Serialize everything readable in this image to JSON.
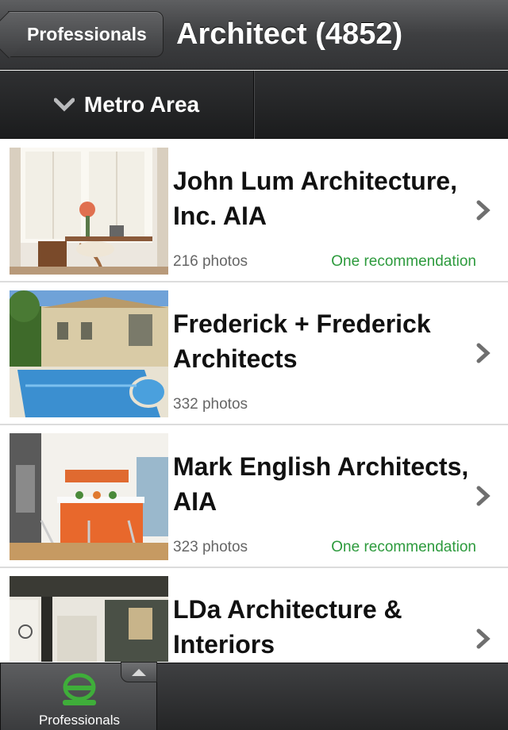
{
  "navbar": {
    "back_label": "Professionals",
    "title": "Architect (4852)"
  },
  "filter": {
    "metro_label": "Metro Area"
  },
  "listings": [
    {
      "name": "John Lum Architecture, Inc. AIA",
      "photos": "216 photos",
      "recommendation": "One recommendation",
      "thumbnail": "interior-desk-window-photo"
    },
    {
      "name": "Frederick + Frederick Architects",
      "photos": "332 photos",
      "recommendation": "",
      "thumbnail": "house-pool-photo"
    },
    {
      "name": "Mark English Architects, AIA",
      "photos": "323 photos",
      "recommendation": "One recommendation",
      "thumbnail": "kitchen-orange-island-photo"
    },
    {
      "name": "LDa Architecture & Interiors",
      "photos": "",
      "recommendation": "",
      "thumbnail": "interior-room-photo"
    }
  ],
  "tabbar": {
    "active_label": "Professionals",
    "active_icon": "professionals-level-icon"
  },
  "colors": {
    "recommendation": "#2c9a3c",
    "tab_icon_green": "#3fae3a"
  }
}
